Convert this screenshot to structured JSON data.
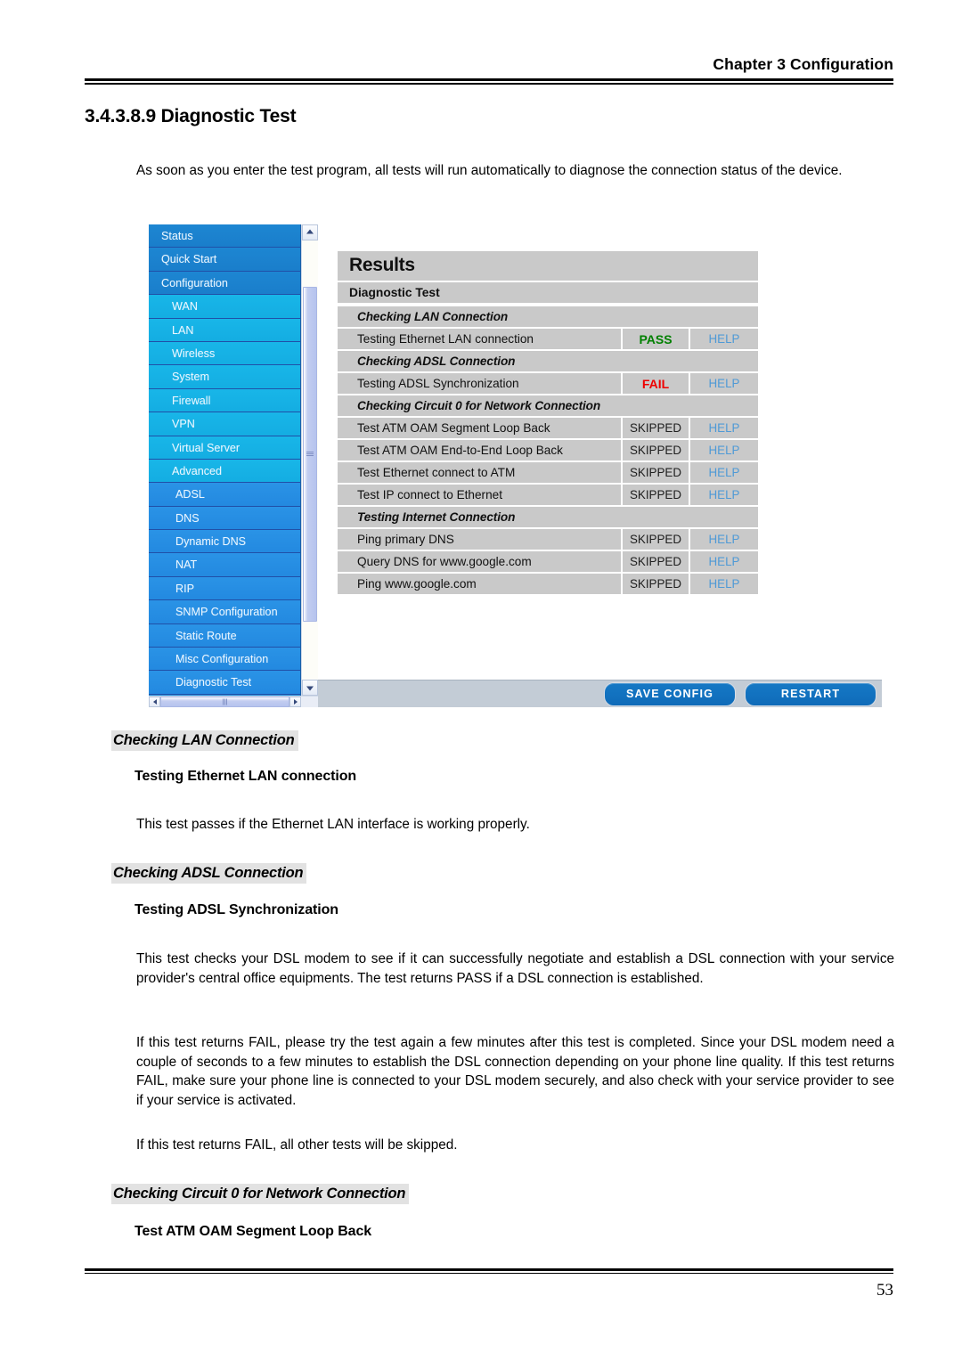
{
  "header": {
    "chapter_title": "Chapter 3 Configuration"
  },
  "section": {
    "heading": "3.4.3.8.9 Diagnostic Test",
    "intro": "As soon as you enter the test program, all tests will run automatically to diagnose the connection status of the device."
  },
  "router_ui": {
    "sidebar": {
      "items": [
        {
          "label": "Status",
          "level": 0
        },
        {
          "label": "Quick Start",
          "level": 0
        },
        {
          "label": "Configuration",
          "level": 0
        },
        {
          "label": "WAN",
          "level": 1
        },
        {
          "label": "LAN",
          "level": 1
        },
        {
          "label": "Wireless",
          "level": 1
        },
        {
          "label": "System",
          "level": 1
        },
        {
          "label": "Firewall",
          "level": 1
        },
        {
          "label": "VPN",
          "level": 1
        },
        {
          "label": "Virtual Server",
          "level": 1
        },
        {
          "label": "Advanced",
          "level": 1
        },
        {
          "label": "ADSL",
          "level": 2
        },
        {
          "label": "DNS",
          "level": 2
        },
        {
          "label": "Dynamic DNS",
          "level": 2
        },
        {
          "label": "NAT",
          "level": 2
        },
        {
          "label": "RIP",
          "level": 2
        },
        {
          "label": "SNMP Configuration",
          "level": 2
        },
        {
          "label": "Static Route",
          "level": 2
        },
        {
          "label": "Misc Configuration",
          "level": 2
        },
        {
          "label": "Diagnostic Test",
          "level": 2
        }
      ]
    },
    "results": {
      "title": "Results",
      "subtitle": "Diagnostic Test",
      "help_label": "HELP",
      "rows": [
        {
          "type": "group",
          "label": "Checking LAN Connection"
        },
        {
          "type": "test",
          "label": "Testing Ethernet LAN connection",
          "status": "PASS",
          "status_kind": "pass"
        },
        {
          "type": "group",
          "label": "Checking ADSL Connection"
        },
        {
          "type": "test",
          "label": "Testing ADSL Synchronization",
          "status": "FAIL",
          "status_kind": "fail"
        },
        {
          "type": "group",
          "label": "Checking Circuit 0 for Network Connection"
        },
        {
          "type": "test",
          "label": "Test ATM OAM Segment Loop Back",
          "status": "SKIPPED",
          "status_kind": "skipped"
        },
        {
          "type": "test",
          "label": "Test ATM OAM End-to-End Loop Back",
          "status": "SKIPPED",
          "status_kind": "skipped"
        },
        {
          "type": "test",
          "label": "Test Ethernet connect to ATM",
          "status": "SKIPPED",
          "status_kind": "skipped"
        },
        {
          "type": "test",
          "label": "Test IP connect to Ethernet",
          "status": "SKIPPED",
          "status_kind": "skipped"
        },
        {
          "type": "group",
          "label": "Testing Internet Connection"
        },
        {
          "type": "test",
          "label": "Ping primary DNS",
          "status": "SKIPPED",
          "status_kind": "skipped"
        },
        {
          "type": "test",
          "label": "Query DNS for www.google.com",
          "status": "SKIPPED",
          "status_kind": "skipped"
        },
        {
          "type": "test",
          "label": "Ping www.google.com",
          "status": "SKIPPED",
          "status_kind": "skipped"
        }
      ]
    },
    "buttons": {
      "save_config": "SAVE CONFIG",
      "restart": "RESTART"
    },
    "colors": {
      "pass": "#008000",
      "fail": "#ee0000",
      "help_link": "#4f9ad6",
      "panel_bg": "#c9c9c9",
      "button_blue": "#1272c0",
      "sidebar_top": "#1a7ecb",
      "sidebar_sub": "#14ade2"
    }
  },
  "doc_sections": [
    {
      "heading": "Checking LAN Connection",
      "sub_heading": "Testing Ethernet LAN connection",
      "paragraphs": [
        "This test passes if the Ethernet LAN interface is working properly."
      ]
    },
    {
      "heading": "Checking ADSL Connection",
      "sub_heading": "Testing ADSL Synchronization",
      "paragraphs": [
        "This test checks your DSL modem to see if it can successfully negotiate and establish a DSL connection with your service provider's central office equipments. The test returns PASS if a DSL connection is established.",
        "If this test returns FAIL, please try the test again a few minutes after this test is completed.  Since your DSL modem need a couple of seconds to a few minutes to establish the DSL connection depending on your phone line quality. If this test returns FAIL, make sure your phone line is connected to your DSL modem securely, and also check with your service provider to see if your service is activated.",
        "If this test returns FAIL, all other tests will be skipped."
      ]
    },
    {
      "heading": "Checking Circuit 0 for Network Connection",
      "sub_heading": "Test ATM OAM Segment Loop Back",
      "paragraphs": []
    }
  ],
  "footer": {
    "page_number": "53"
  }
}
